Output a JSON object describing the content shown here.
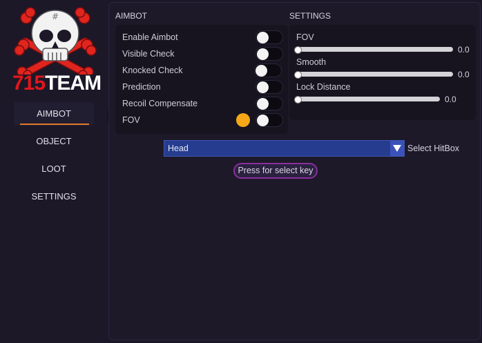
{
  "logo": {
    "text_number": "715",
    "text_team": "TEAM"
  },
  "nav": {
    "items": [
      {
        "label": "AIMBOT",
        "active": true
      },
      {
        "label": "OBJECT",
        "active": false
      },
      {
        "label": "LOOT",
        "active": false
      },
      {
        "label": "SETTINGS",
        "active": false
      }
    ]
  },
  "aimbot": {
    "title": "AIMBOT",
    "toggles": [
      {
        "label": "Enable Aimbot",
        "on": false
      },
      {
        "label": "Visible Check",
        "on": false
      },
      {
        "label": "Knocked Check",
        "on": false
      },
      {
        "label": "Prediction",
        "on": false
      },
      {
        "label": "Recoil Compensate",
        "on": false
      },
      {
        "label": "FOV",
        "on": false
      }
    ],
    "fov_color": "#f6a717"
  },
  "settings": {
    "title": "SETTINGS",
    "sliders": [
      {
        "label": "FOV",
        "value": "0.0"
      },
      {
        "label": "Smooth",
        "value": "0.0"
      },
      {
        "label": "Lock Distance",
        "value": "0.0"
      }
    ]
  },
  "hitbox": {
    "selected": "Head",
    "label": "Select HitBox"
  },
  "key_button": {
    "label": "Press for select key"
  }
}
